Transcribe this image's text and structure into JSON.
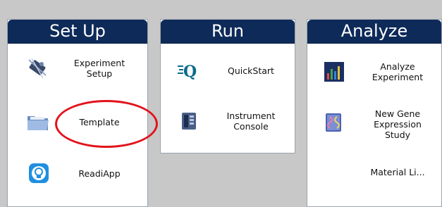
{
  "panels": {
    "setup": {
      "title": "Set Up",
      "items": [
        {
          "label": "Experiment\nSetup",
          "icon": "experiment-setup-icon"
        },
        {
          "label": "Template",
          "icon": "folder-icon"
        },
        {
          "label": "ReadiApp",
          "icon": "lightbulb-app-icon"
        }
      ]
    },
    "run": {
      "title": "Run",
      "items": [
        {
          "label": "QuickStart",
          "icon": "quickstart-q-icon"
        },
        {
          "label": "Instrument\nConsole",
          "icon": "instrument-icon"
        }
      ]
    },
    "analyze": {
      "title": "Analyze",
      "items": [
        {
          "label": "Analyze\nExperiment",
          "icon": "bar-chart-icon"
        },
        {
          "label": "New Gene\nExpression\nStudy",
          "icon": "gene-book-icon"
        },
        {
          "label": "Material Li...",
          "icon": ""
        }
      ]
    }
  },
  "colors": {
    "header_bg": "#0d2a59",
    "background": "#c8c8c8",
    "annotation": "#e2141c"
  }
}
